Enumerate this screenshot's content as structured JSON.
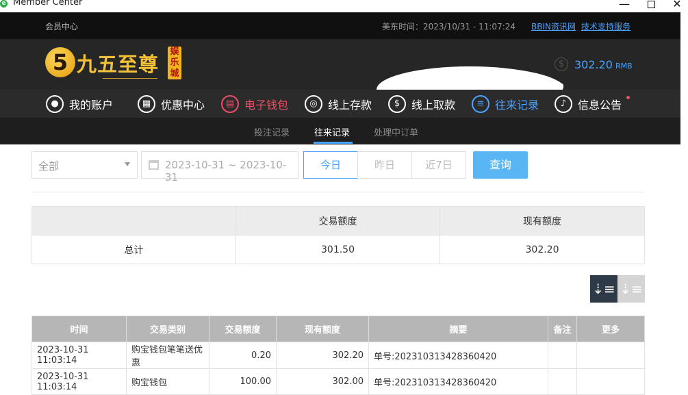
{
  "window": {
    "title": "Member Center"
  },
  "topbar": {
    "member_center": "会员中心",
    "east_time": "美东时间：2023/10/31 - 11:07:24",
    "link_bbin": "BBIN资讯网",
    "link_support": "技术支持服务"
  },
  "header": {
    "logo_text": "九五至尊",
    "logo_badge": "娱乐城",
    "balance": "302.20",
    "currency": "RMB"
  },
  "nav": {
    "items": [
      {
        "label": "我的账户",
        "icon": "user-icon"
      },
      {
        "label": "优惠中心",
        "icon": "gift-icon"
      },
      {
        "label": "电子钱包",
        "icon": "wallet-icon"
      },
      {
        "label": "线上存款",
        "icon": "deposit-icon"
      },
      {
        "label": "线上取款",
        "icon": "withdraw-icon"
      },
      {
        "label": "往来记录",
        "icon": "record-icon"
      },
      {
        "label": "信息公告",
        "icon": "bell-icon"
      }
    ]
  },
  "subnav": {
    "tabs": [
      {
        "label": "投注记录"
      },
      {
        "label": "往来记录"
      },
      {
        "label": "处理中订单"
      }
    ]
  },
  "filters": {
    "type_selected": "全部",
    "date_range": "2023-10-31 ~ 2023-10-31",
    "today": "今日",
    "yesterday": "昨日",
    "last7": "近7日",
    "query": "查询"
  },
  "summary": {
    "headers": [
      "",
      "交易额度",
      "现有额度"
    ],
    "total_label": "总计",
    "total_amount": "301.50",
    "current_balance": "302.20"
  },
  "records": {
    "headers": [
      "时间",
      "交易类别",
      "交易额度",
      "现有额度",
      "摘要",
      "备注",
      "更多"
    ],
    "rows": [
      {
        "time": "2023-10-31 11:03:14",
        "type": "购宝钱包笔笔送优惠",
        "amount": "0.20",
        "balance": "302.20",
        "summary": "单号:202310313428360420",
        "note": "",
        "more": ""
      },
      {
        "time": "2023-10-31 11:03:14",
        "type": "购宝钱包",
        "amount": "100.00",
        "balance": "302.00",
        "summary": "单号:202310313428360420",
        "note": "",
        "more": ""
      }
    ]
  }
}
